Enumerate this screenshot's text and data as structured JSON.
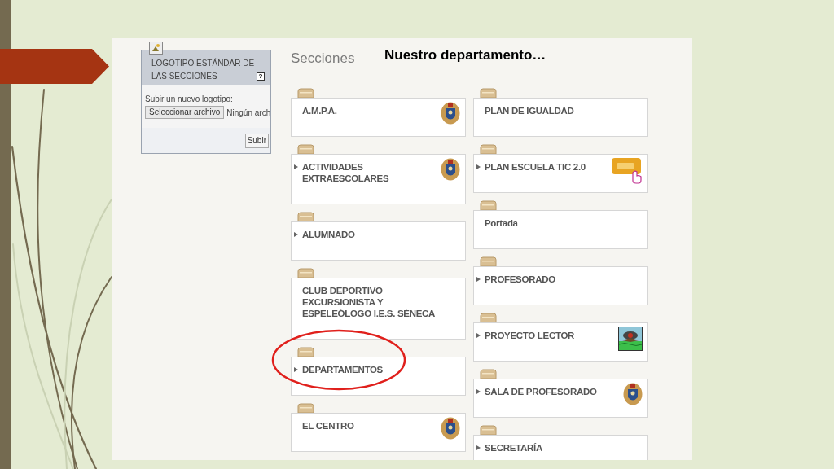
{
  "slide": {
    "title": "Nuestro departamento…"
  },
  "upload_panel": {
    "title": "LOGOTIPO ESTÁNDAR DE LAS SECCIONES",
    "help": "?",
    "label": "Subir un nuevo logotipo:",
    "choose_button": "Seleccionar archivo",
    "file_status": "Ningún arch",
    "submit_button": "Subir"
  },
  "heading": "Secciones",
  "columns": [
    [
      {
        "label": "A.M.P.A.",
        "expandable": false,
        "kind": "crest",
        "highlighted": false
      },
      {
        "label": "ACTIVIDADES EXTRAESCOLARES",
        "expandable": true,
        "kind": "crest",
        "highlighted": false
      },
      {
        "label": "ALUMNADO",
        "expandable": true,
        "kind": "plain",
        "highlighted": false
      },
      {
        "label": "CLUB DEPORTIVO EXCURSIONISTA Y ESPELEÓLOGO I.E.S. SÉNECA",
        "expandable": false,
        "kind": "plain",
        "highlighted": false
      },
      {
        "label": "DEPARTAMENTOS",
        "expandable": true,
        "kind": "plain",
        "highlighted": true
      },
      {
        "label": "EL CENTRO",
        "expandable": false,
        "kind": "crest",
        "highlighted": false
      }
    ],
    [
      {
        "label": "PLAN DE IGUALDAD",
        "expandable": false,
        "kind": "plain",
        "highlighted": false
      },
      {
        "label": "PLAN ESCUELA TIC 2.0",
        "expandable": true,
        "kind": "tic",
        "highlighted": false
      },
      {
        "label": "Portada",
        "expandable": false,
        "kind": "plain",
        "highlighted": false
      },
      {
        "label": "PROFESORADO",
        "expandable": true,
        "kind": "plain",
        "highlighted": false
      },
      {
        "label": "PROYECTO LECTOR",
        "expandable": true,
        "kind": "reader",
        "highlighted": false
      },
      {
        "label": "SALA DE PROFESORADO",
        "expandable": true,
        "kind": "crest",
        "highlighted": false
      },
      {
        "label": "SECRETARÍA",
        "expandable": true,
        "kind": "plain",
        "highlighted": false
      }
    ]
  ]
}
